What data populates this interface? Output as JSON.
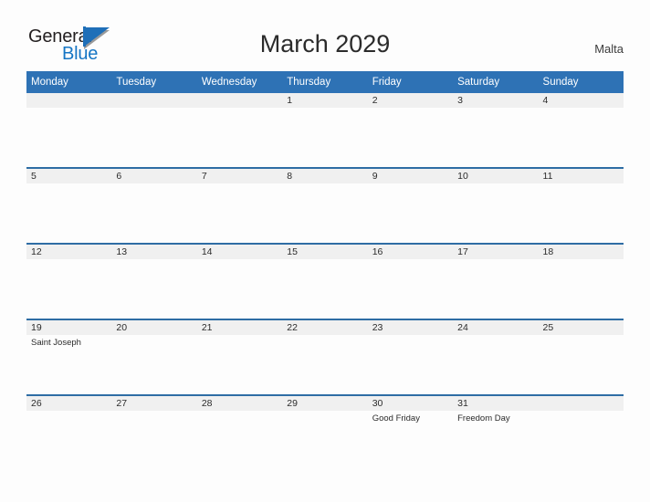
{
  "brand": {
    "line1": "General",
    "line2": "Blue",
    "accent_color": "#1f6fb8"
  },
  "header": {
    "title": "March 2029",
    "country": "Malta"
  },
  "calendar": {
    "header_color": "#2e72b5",
    "row_line_color": "#2e6da4",
    "band_color": "#f0f0f0",
    "weekday_labels": [
      "Monday",
      "Tuesday",
      "Wednesday",
      "Thursday",
      "Friday",
      "Saturday",
      "Sunday"
    ],
    "weeks": [
      [
        {
          "date": "",
          "events": []
        },
        {
          "date": "",
          "events": []
        },
        {
          "date": "",
          "events": []
        },
        {
          "date": "1",
          "events": []
        },
        {
          "date": "2",
          "events": []
        },
        {
          "date": "3",
          "events": []
        },
        {
          "date": "4",
          "events": []
        }
      ],
      [
        {
          "date": "5",
          "events": []
        },
        {
          "date": "6",
          "events": []
        },
        {
          "date": "7",
          "events": []
        },
        {
          "date": "8",
          "events": []
        },
        {
          "date": "9",
          "events": []
        },
        {
          "date": "10",
          "events": []
        },
        {
          "date": "11",
          "events": []
        }
      ],
      [
        {
          "date": "12",
          "events": []
        },
        {
          "date": "13",
          "events": []
        },
        {
          "date": "14",
          "events": []
        },
        {
          "date": "15",
          "events": []
        },
        {
          "date": "16",
          "events": []
        },
        {
          "date": "17",
          "events": []
        },
        {
          "date": "18",
          "events": []
        }
      ],
      [
        {
          "date": "19",
          "events": [
            "Saint Joseph"
          ]
        },
        {
          "date": "20",
          "events": []
        },
        {
          "date": "21",
          "events": []
        },
        {
          "date": "22",
          "events": []
        },
        {
          "date": "23",
          "events": []
        },
        {
          "date": "24",
          "events": []
        },
        {
          "date": "25",
          "events": []
        }
      ],
      [
        {
          "date": "26",
          "events": []
        },
        {
          "date": "27",
          "events": []
        },
        {
          "date": "28",
          "events": []
        },
        {
          "date": "29",
          "events": []
        },
        {
          "date": "30",
          "events": [
            "Good Friday"
          ]
        },
        {
          "date": "31",
          "events": [
            "Freedom Day"
          ]
        },
        {
          "date": "",
          "events": []
        }
      ]
    ]
  }
}
